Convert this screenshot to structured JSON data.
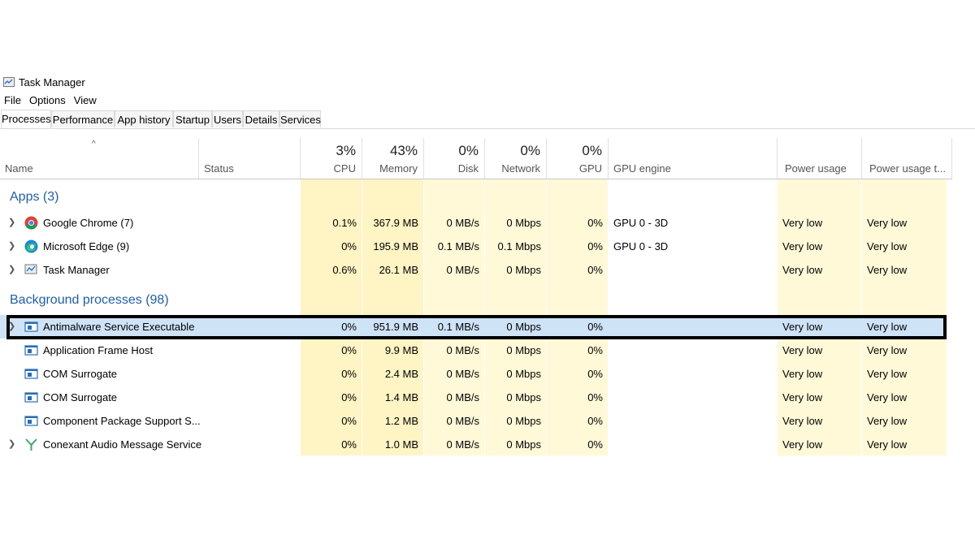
{
  "window": {
    "title": "Task Manager",
    "icon": "task-manager-icon"
  },
  "menu": [
    "File",
    "Options",
    "View"
  ],
  "tabs": [
    "Processes",
    "Performance",
    "App history",
    "Startup",
    "Users",
    "Details",
    "Services"
  ],
  "active_tab": "Processes",
  "columns": {
    "name": "Name",
    "status": "Status",
    "cpu": {
      "pct": "3%",
      "label": "CPU"
    },
    "memory": {
      "pct": "43%",
      "label": "Memory"
    },
    "disk": {
      "pct": "0%",
      "label": "Disk"
    },
    "network": {
      "pct": "0%",
      "label": "Network"
    },
    "gpu": {
      "pct": "0%",
      "label": "GPU"
    },
    "gpu_engine": "GPU engine",
    "power": "Power usage",
    "power_trend": "Power usage t..."
  },
  "groups": {
    "apps": "Apps (3)",
    "background": "Background processes (98)"
  },
  "apps": [
    {
      "name": "Google Chrome (7)",
      "icon": "chrome-icon",
      "expandable": true,
      "cpu": "0.1%",
      "memory": "367.9 MB",
      "disk": "0 MB/s",
      "network": "0 Mbps",
      "gpu": "0%",
      "gpu_engine": "GPU 0 - 3D",
      "power": "Very low",
      "power_trend": "Very low"
    },
    {
      "name": "Microsoft Edge (9)",
      "icon": "edge-icon",
      "expandable": true,
      "cpu": "0%",
      "memory": "195.9 MB",
      "disk": "0.1 MB/s",
      "network": "0.1 Mbps",
      "gpu": "0%",
      "gpu_engine": "GPU 0 - 3D",
      "power": "Very low",
      "power_trend": "Very low"
    },
    {
      "name": "Task Manager",
      "icon": "task-manager-icon",
      "expandable": true,
      "cpu": "0.6%",
      "memory": "26.1 MB",
      "disk": "0 MB/s",
      "network": "0 Mbps",
      "gpu": "0%",
      "gpu_engine": "",
      "power": "Very low",
      "power_trend": "Very low"
    }
  ],
  "background": [
    {
      "name": "Antimalware Service Executable",
      "icon": "service-window-icon",
      "expandable": true,
      "selected": true,
      "cpu": "0%",
      "memory": "951.9 MB",
      "disk": "0.1 MB/s",
      "network": "0 Mbps",
      "gpu": "0%",
      "gpu_engine": "",
      "power": "Very low",
      "power_trend": "Very low"
    },
    {
      "name": "Application Frame Host",
      "icon": "service-window-icon",
      "expandable": false,
      "cpu": "0%",
      "memory": "9.9 MB",
      "disk": "0 MB/s",
      "network": "0 Mbps",
      "gpu": "0%",
      "gpu_engine": "",
      "power": "Very low",
      "power_trend": "Very low"
    },
    {
      "name": "COM Surrogate",
      "icon": "service-window-icon",
      "expandable": false,
      "cpu": "0%",
      "memory": "2.4 MB",
      "disk": "0 MB/s",
      "network": "0 Mbps",
      "gpu": "0%",
      "gpu_engine": "",
      "power": "Very low",
      "power_trend": "Very low"
    },
    {
      "name": "COM Surrogate",
      "icon": "service-window-icon",
      "expandable": false,
      "cpu": "0%",
      "memory": "1.4 MB",
      "disk": "0 MB/s",
      "network": "0 Mbps",
      "gpu": "0%",
      "gpu_engine": "",
      "power": "Very low",
      "power_trend": "Very low"
    },
    {
      "name": "Component Package Support S...",
      "icon": "service-window-icon",
      "expandable": false,
      "cpu": "0%",
      "memory": "1.2 MB",
      "disk": "0 MB/s",
      "network": "0 Mbps",
      "gpu": "0%",
      "gpu_engine": "",
      "power": "Very low",
      "power_trend": "Very low"
    },
    {
      "name": "Conexant Audio Message Service",
      "icon": "conexant-icon",
      "expandable": true,
      "cpu": "0%",
      "memory": "1.0 MB",
      "disk": "0 MB/s",
      "network": "0 Mbps",
      "gpu": "0%",
      "gpu_engine": "",
      "power": "Very low",
      "power_trend": "Very low"
    }
  ],
  "colors": {
    "heat": "#fff4c4",
    "group_title": "#1f5fa8",
    "selection": "#cfe3f7",
    "highlight_border": "#000000"
  }
}
